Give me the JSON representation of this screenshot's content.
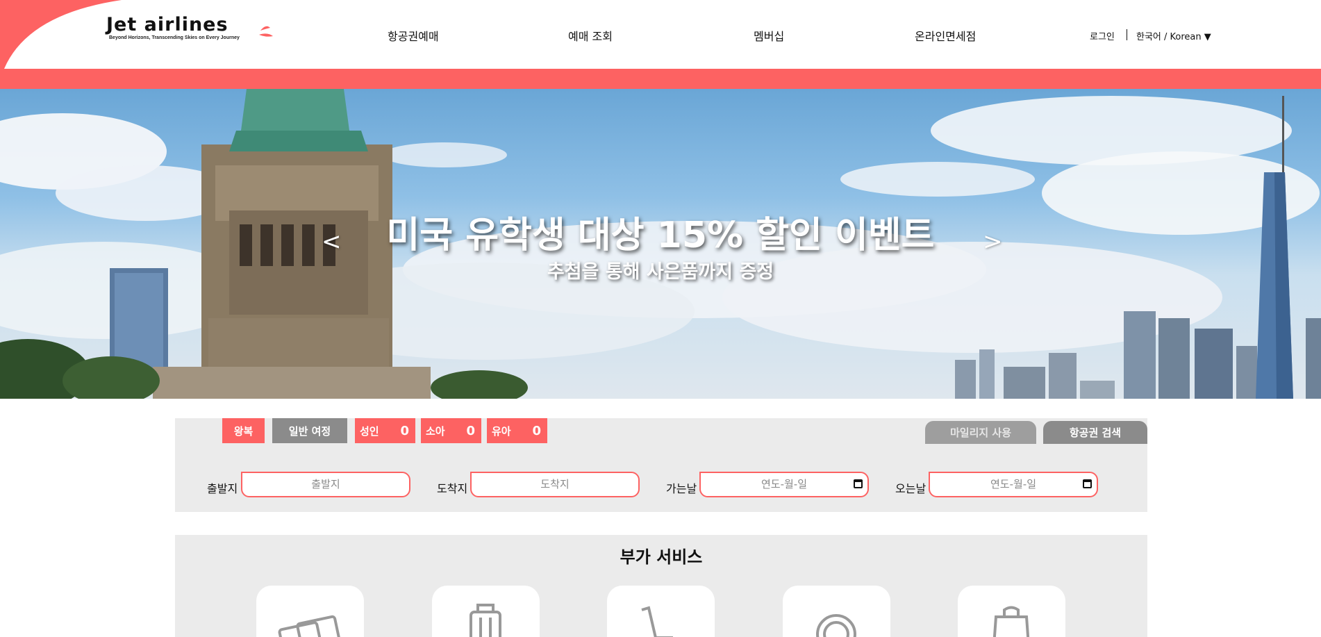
{
  "brand": {
    "name": "Jet airlines",
    "tagline": "Beyond Horizons, Transcending Skies on Every Journey",
    "accent_color": "#fd6262"
  },
  "nav": {
    "items": [
      "항공권예매",
      "예매 조회",
      "멤버십",
      "온라인면세점"
    ]
  },
  "utility": {
    "login": "로그인",
    "language": "한국어 / Korean ▼"
  },
  "hero": {
    "title": "미국 유학생 대상 15% 할인 이벤트",
    "subtitle": "추첨을 통해 사은품까지 증정",
    "prev": "<",
    "next": ">"
  },
  "booking": {
    "trip_tabs": [
      "왕복",
      "일반 여정"
    ],
    "counters": [
      {
        "label": "성인",
        "value": "0"
      },
      {
        "label": "소아",
        "value": "0"
      },
      {
        "label": "유아",
        "value": "0"
      }
    ],
    "mileage_tab": "마일리지 사용",
    "search_tab": "항공권 검색",
    "fields": [
      {
        "label": "출발지",
        "placeholder": "출발지"
      },
      {
        "label": "도착지",
        "placeholder": "도착지"
      },
      {
        "label": "가는날",
        "placeholder": "연도-월-일"
      },
      {
        "label": "오는날",
        "placeholder": "연도-월-일"
      }
    ]
  },
  "services": {
    "title": "부가 서비스",
    "icons": [
      "ticket-icon",
      "luggage-icon",
      "seat-icon",
      "meal-icon",
      "duty-free-bag-icon"
    ]
  }
}
